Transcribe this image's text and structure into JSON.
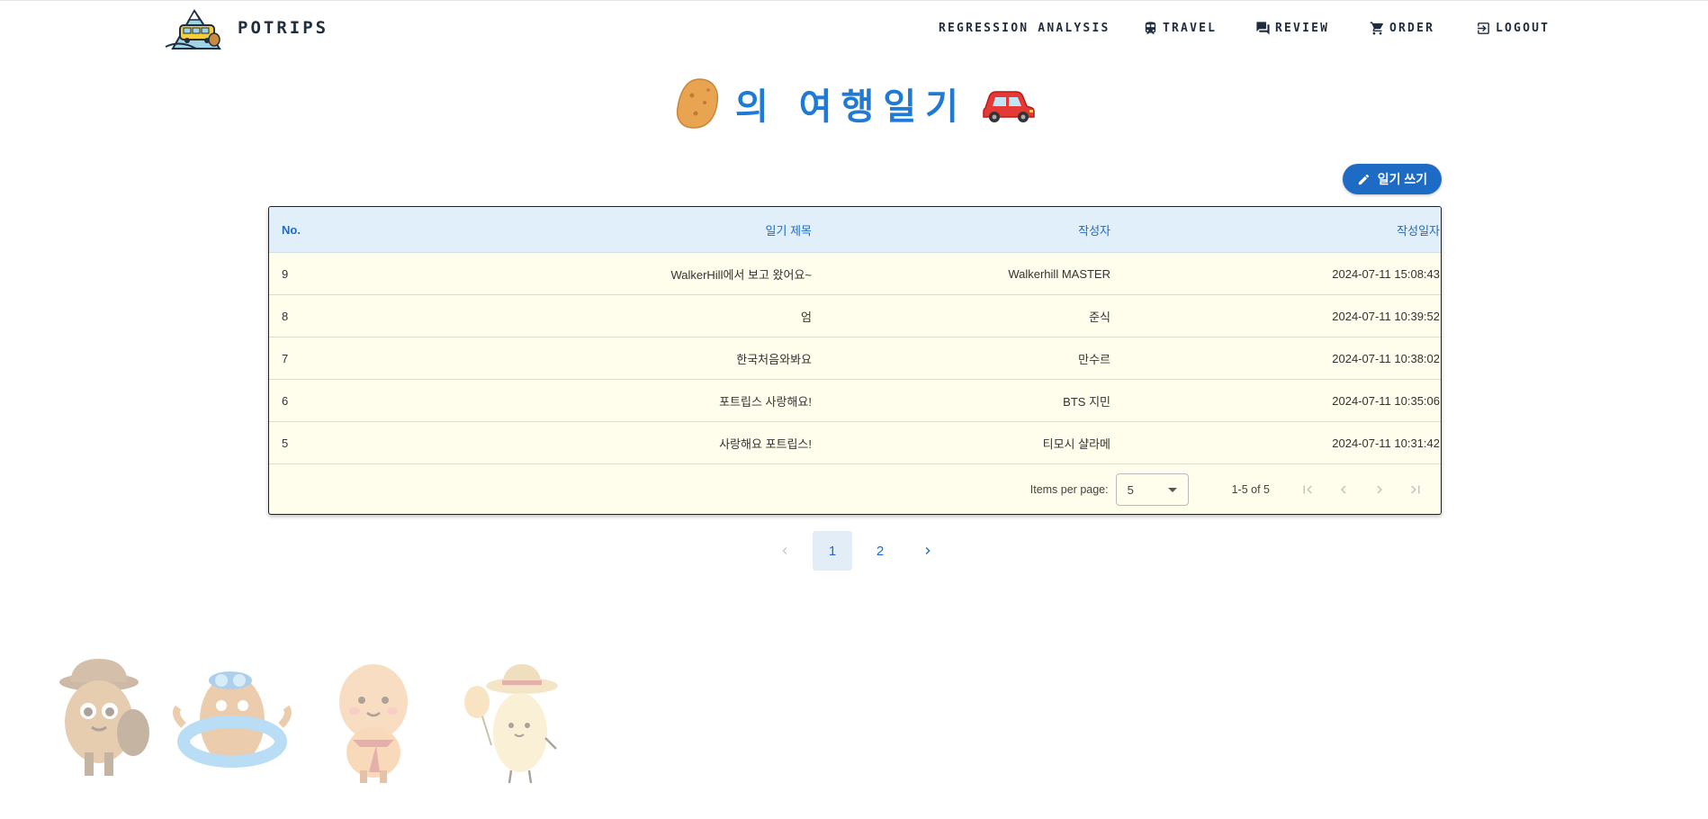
{
  "header": {
    "brand": "POTRIPS",
    "nav": [
      {
        "label": "REGRESSION ANALYSIS",
        "icon": "none"
      },
      {
        "label": "TRAVEL",
        "icon": "train-icon"
      },
      {
        "label": "REVIEW",
        "icon": "chat-icon"
      },
      {
        "label": "ORDER",
        "icon": "cart-icon"
      },
      {
        "label": "LOGOUT",
        "icon": "logout-icon"
      }
    ]
  },
  "page": {
    "title": "의 여행일기",
    "write_button": "일기 쓰기"
  },
  "table": {
    "headers": [
      "No.",
      "일기 제목",
      "작성자",
      "작성일자"
    ],
    "rows": [
      {
        "no": "9",
        "title": "WalkerHill에서 보고 왔어요~",
        "author": "Walkerhill MASTER",
        "date": "2024-07-11 15:08:43"
      },
      {
        "no": "8",
        "title": "엄",
        "author": "준식",
        "date": "2024-07-11 10:39:52"
      },
      {
        "no": "7",
        "title": "한국처음와봐요",
        "author": "만수르",
        "date": "2024-07-11 10:38:02"
      },
      {
        "no": "6",
        "title": "포트립스 사랑해요!",
        "author": "BTS 지민",
        "date": "2024-07-11 10:35:06"
      },
      {
        "no": "5",
        "title": "사랑해요 포트립스!",
        "author": "티모시 샬라메",
        "date": "2024-07-11 10:31:42"
      }
    ],
    "paginator": {
      "items_per_page_label": "Items per page:",
      "items_per_page_value": "5",
      "range": "1-5 of 5"
    }
  },
  "pager": {
    "pages": [
      "1",
      "2"
    ],
    "active": "1"
  },
  "colors": {
    "accent": "#1e6bc5",
    "title_blue": "#1f7ad6",
    "table_header_bg": "#e1effb",
    "table_body_bg": "#fffdeb"
  }
}
